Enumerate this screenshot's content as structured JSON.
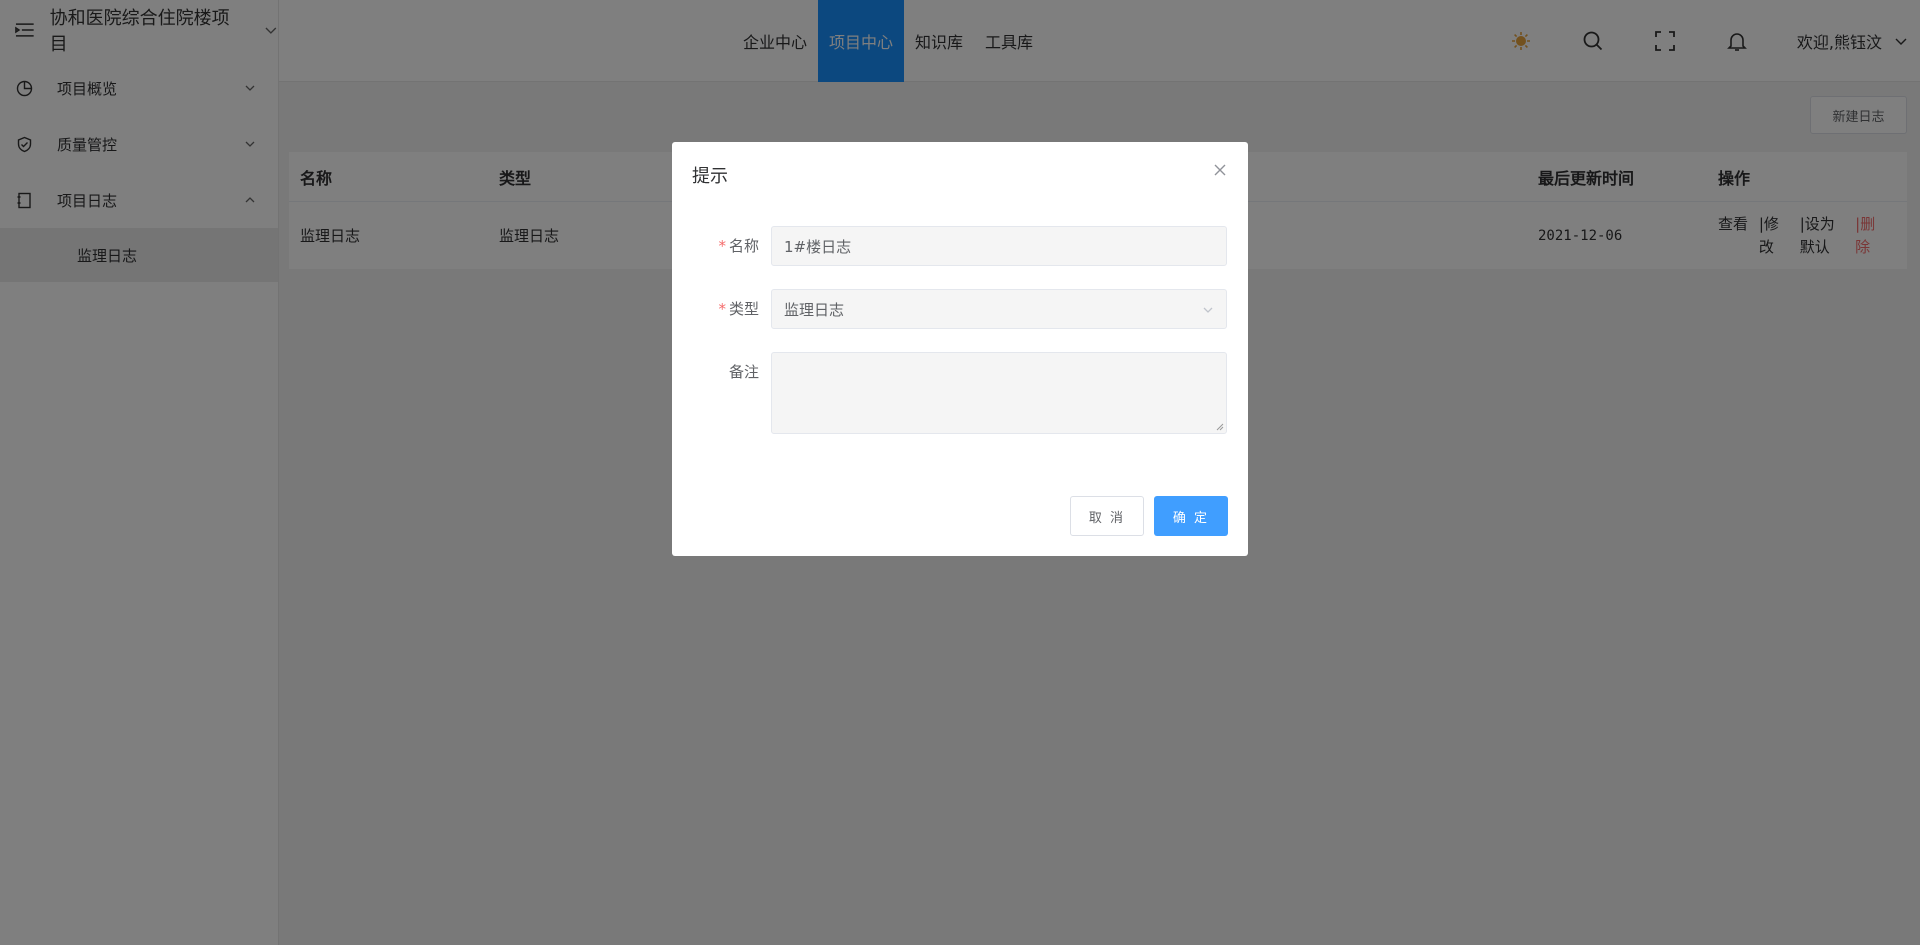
{
  "sidebar": {
    "project_title": "协和医院综合住院楼项目",
    "items": [
      {
        "label": "项目概览"
      },
      {
        "label": "质量管控"
      },
      {
        "label": "项目日志"
      }
    ],
    "sub_items": [
      {
        "label": "监理日志"
      }
    ]
  },
  "topnav": {
    "tabs": [
      {
        "label": "企业中心"
      },
      {
        "label": "项目中心"
      },
      {
        "label": "知识库"
      },
      {
        "label": "工具库"
      }
    ],
    "active_tab": "项目中心",
    "welcome": "欢迎,熊钰汶",
    "icons": [
      "sun-icon",
      "search-icon",
      "fullscreen-icon",
      "bell-icon"
    ]
  },
  "main": {
    "new_button": "新建日志",
    "table": {
      "headers": [
        "名称",
        "类型",
        "最后更新时间",
        "操作"
      ],
      "rows": [
        {
          "name": "监理日志",
          "type": "监理日志",
          "updated": "2021-12-06",
          "actions": [
            "查看",
            "|修改",
            "|设为默认",
            "|删除"
          ]
        }
      ]
    }
  },
  "modal": {
    "title": "提示",
    "fields": {
      "name_label": "名称",
      "name_value": "1#楼日志",
      "type_label": "类型",
      "type_value": "监理日志",
      "remark_label": "备注",
      "remark_value": ""
    },
    "cancel_label": "取 消",
    "confirm_label": "确 定"
  },
  "colors": {
    "accent": "#1890ff",
    "primary_button": "#409eff",
    "danger": "#f56c6c",
    "required": "#f56c6c",
    "sun": "#e6a23c"
  }
}
